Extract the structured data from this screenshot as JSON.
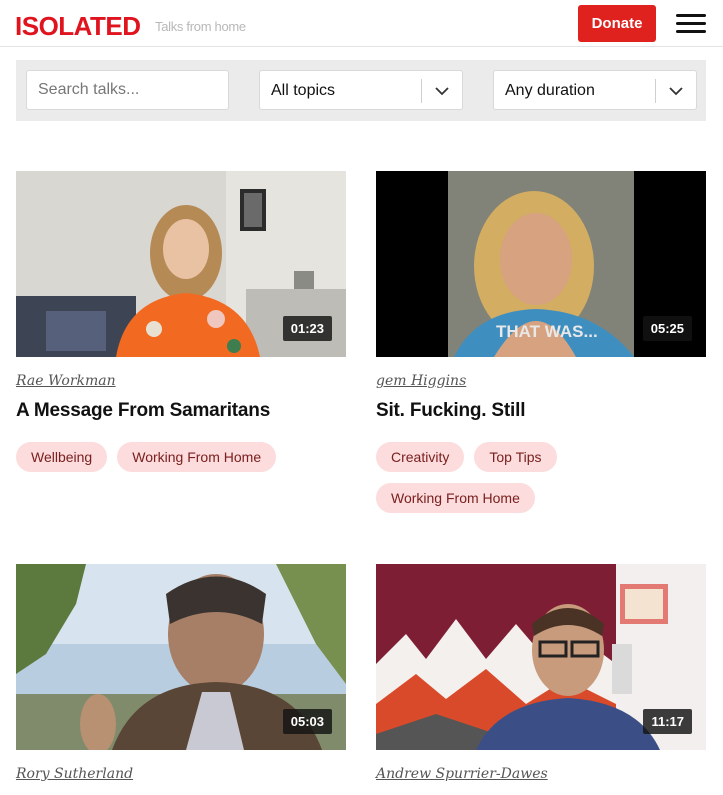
{
  "header": {
    "logo": "ISOLATED",
    "tagline": "Talks from home",
    "donate_label": "Donate"
  },
  "filters": {
    "search_placeholder": "Search talks...",
    "topics_selected": "All topics",
    "duration_selected": "Any duration"
  },
  "talks": [
    {
      "speaker": "Rae Workman",
      "title": "A Message From Samaritans",
      "duration": "01:23",
      "tags": [
        "Wellbeing",
        "Working From Home"
      ]
    },
    {
      "speaker": "gem Higgins",
      "title": "Sit. Fucking. Still",
      "duration": "05:25",
      "thumb_caption": "THAT WAS...",
      "tags": [
        "Creativity",
        "Top Tips",
        "Working From Home"
      ]
    },
    {
      "speaker": "Rory Sutherland",
      "title": "",
      "duration": "05:03",
      "tags": []
    },
    {
      "speaker": "Andrew Spurrier-Dawes",
      "title": "",
      "duration": "11:17",
      "tags": []
    }
  ],
  "colors": {
    "brand_red": "#e0141e",
    "tag_bg": "#fcdcdc",
    "tag_text": "#7a2020",
    "filter_bar_bg": "#ebebeb"
  },
  "icons": [
    "menu-icon",
    "chevron-down-icon"
  ]
}
